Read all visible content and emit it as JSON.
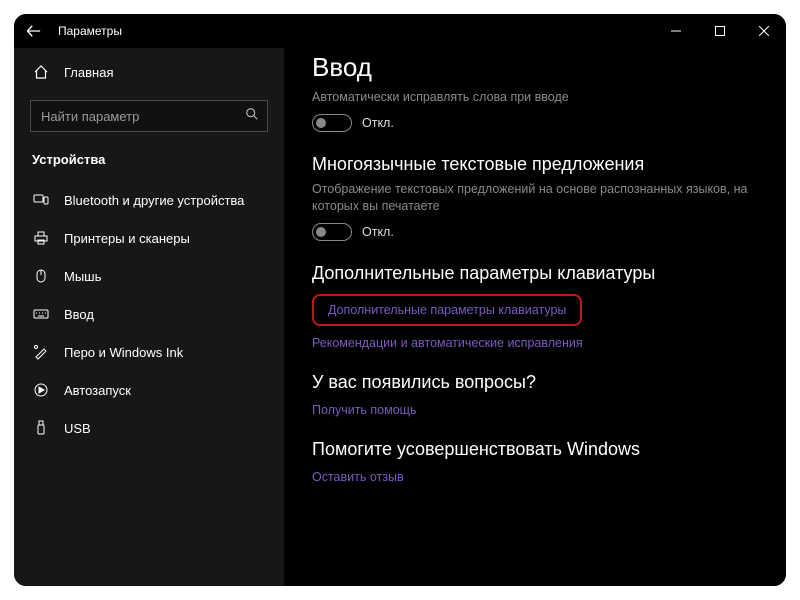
{
  "titlebar": {
    "title": "Параметры"
  },
  "sidebar": {
    "home": "Главная",
    "search_placeholder": "Найти параметр",
    "category": "Устройства",
    "items": [
      {
        "label": "Bluetooth и другие устройства"
      },
      {
        "label": "Принтеры и сканеры"
      },
      {
        "label": "Мышь"
      },
      {
        "label": "Ввод"
      },
      {
        "label": "Перо и Windows Ink"
      },
      {
        "label": "Автозапуск"
      },
      {
        "label": "USB"
      }
    ]
  },
  "main": {
    "heading": "Ввод",
    "autocorrect_desc": "Автоматически исправлять слова при вводе",
    "off1": "Откл.",
    "section_multi_title": "Многоязычные текстовые предложения",
    "multi_desc": "Отображение текстовых предложений на основе распознанных языков, на которых вы печатаете",
    "off2": "Откл.",
    "section_adv_title": "Дополнительные параметры клавиатуры",
    "adv_link": "Дополнительные параметры клавиатуры",
    "auto_link": "Рекомендации и автоматические исправления",
    "section_help_title": "У вас появились вопросы?",
    "help_link": "Получить помощь",
    "section_feedback_title": "Помогите усовершенствовать Windows",
    "feedback_link": "Оставить отзыв"
  }
}
